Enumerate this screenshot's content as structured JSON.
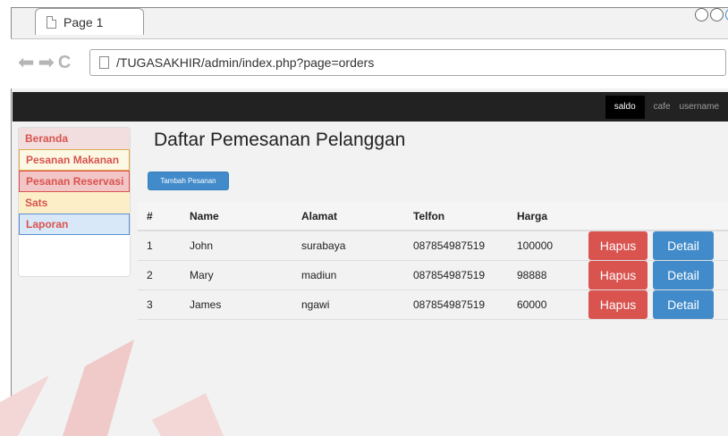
{
  "browser": {
    "tab_title": "Page 1",
    "url": "/TUGASAKHIR/admin/index.php?page=orders",
    "nav_icons": [
      "back-arrow-icon",
      "forward-arrow-icon",
      "reload-icon"
    ]
  },
  "navbar": {
    "items": [
      "saldo",
      "cafe",
      "username"
    ],
    "colors": {
      "background": "#222222",
      "active": "#000000"
    }
  },
  "sidebar": {
    "items": [
      {
        "label": "Beranda",
        "style": "danger"
      },
      {
        "label": "Pesanan Makanan",
        "style": "warning"
      },
      {
        "label": "Pesanan Reservasi",
        "style": "danger"
      },
      {
        "label": "Sats",
        "style": "warning"
      },
      {
        "label": "Laporan",
        "style": "info"
      }
    ]
  },
  "main": {
    "title": "Daftar Pemesanan Pelanggan",
    "add_button": "Tambah Pesanan",
    "table": {
      "headers": [
        "#",
        "Name",
        "Alamat",
        "Telfon",
        "Harga"
      ],
      "rows": [
        {
          "num": "1",
          "name": "John",
          "alamat": "surabaya",
          "telfon": "087854987519",
          "harga": "100000"
        },
        {
          "num": "2",
          "name": "Mary",
          "alamat": "madiun",
          "telfon": "087854987519",
          "harga": "98888"
        },
        {
          "num": "3",
          "name": "James",
          "alamat": "ngawi",
          "telfon": "087854987519",
          "harga": "60000"
        }
      ],
      "hapus_label": "Hapus",
      "detail_label": "Detail"
    }
  },
  "colors": {
    "primary": "#428bca",
    "danger": "#d9534f"
  }
}
